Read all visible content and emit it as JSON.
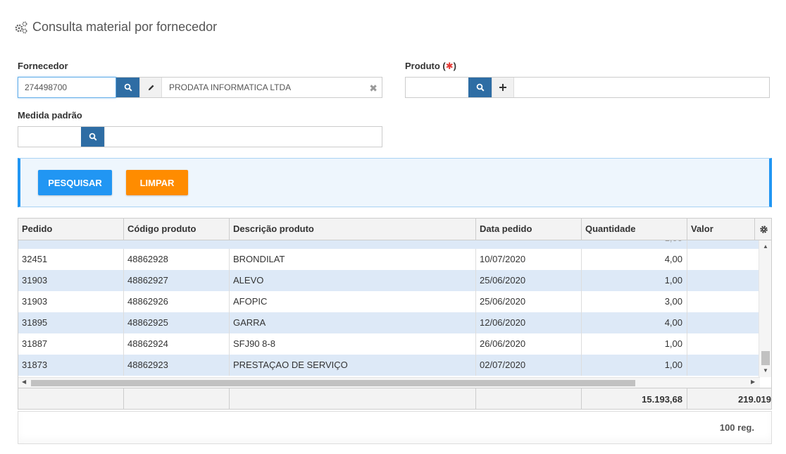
{
  "page": {
    "title": "Consulta material por fornecedor",
    "icon": "gears-icon"
  },
  "form": {
    "fornecedor": {
      "label": "Fornecedor",
      "code_value": "274498700",
      "description": "PRODATA INFORMATICA LTDA"
    },
    "produto": {
      "label": "Produto (",
      "required_mark": "✱",
      "label_close": ")",
      "code_value": "",
      "description": ""
    },
    "medida": {
      "label": "Medida padrão",
      "code_value": "",
      "description": ""
    }
  },
  "actions": {
    "search_label": "PESQUISAR",
    "clear_label": "LIMPAR"
  },
  "colors": {
    "primary": "#2196f3",
    "warning": "#ff8c00",
    "search_btn": "#2e6da4",
    "row_alt": "#dde9f7"
  },
  "grid": {
    "columns": [
      "Pedido",
      "Código produto",
      "Descrição produto",
      "Data pedido",
      "Quantidade",
      "Valor"
    ],
    "rows": [
      {
        "pedido": "32451",
        "codigo": "48862928",
        "descricao": "BRONDILAT",
        "data": "10/07/2020",
        "quantidade": "4,00",
        "valor": ""
      },
      {
        "pedido": "31903",
        "codigo": "48862927",
        "descricao": "ALEVO",
        "data": "25/06/2020",
        "quantidade": "1,00",
        "valor": ""
      },
      {
        "pedido": "31903",
        "codigo": "48862926",
        "descricao": "AFOPIC",
        "data": "25/06/2020",
        "quantidade": "3,00",
        "valor": ""
      },
      {
        "pedido": "31895",
        "codigo": "48862925",
        "descricao": "GARRA",
        "data": "12/06/2020",
        "quantidade": "4,00",
        "valor": ""
      },
      {
        "pedido": "31887",
        "codigo": "48862924",
        "descricao": "SFJ90 8-8",
        "data": "26/06/2020",
        "quantidade": "1,00",
        "valor": ""
      },
      {
        "pedido": "31873",
        "codigo": "48862923",
        "descricao": "PRESTAÇAO DE SERVIÇO",
        "data": "02/07/2020",
        "quantidade": "1,00",
        "valor": ""
      }
    ],
    "totals": {
      "quantidade": "15.193,68",
      "valor": "219.019"
    },
    "record_count": "100 reg."
  }
}
